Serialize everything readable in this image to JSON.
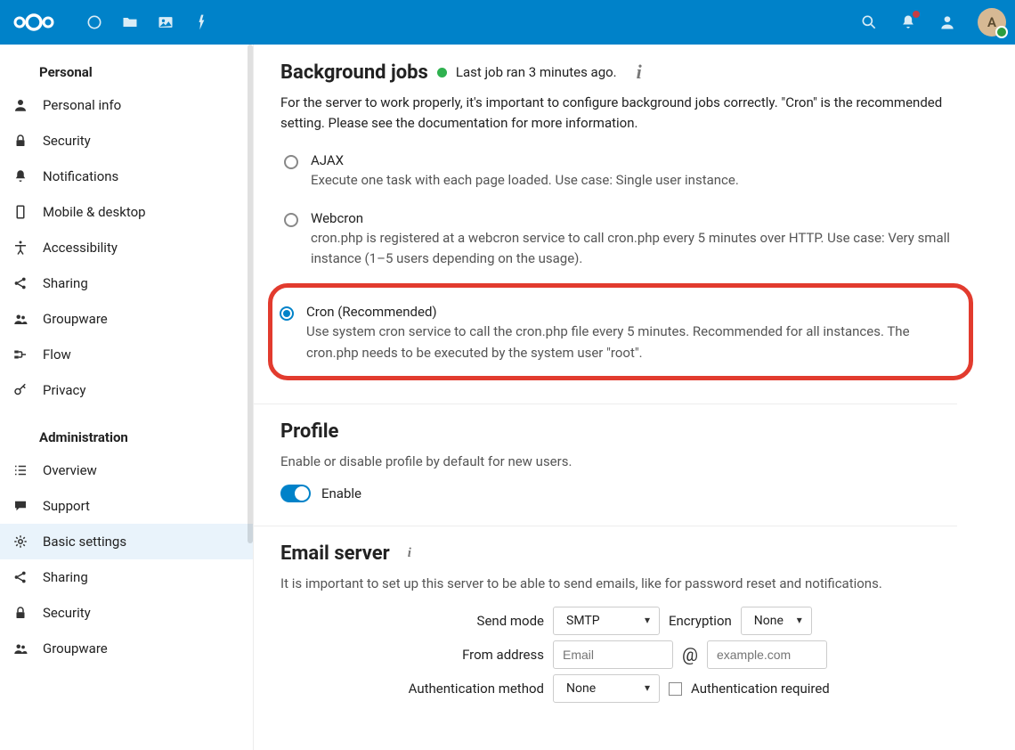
{
  "avatar_initial": "A",
  "sidebar": {
    "personal_heading": "Personal",
    "admin_heading": "Administration",
    "personal": [
      {
        "label": "Personal info"
      },
      {
        "label": "Security"
      },
      {
        "label": "Notifications"
      },
      {
        "label": "Mobile & desktop"
      },
      {
        "label": "Accessibility"
      },
      {
        "label": "Sharing"
      },
      {
        "label": "Groupware"
      },
      {
        "label": "Flow"
      },
      {
        "label": "Privacy"
      }
    ],
    "admin": [
      {
        "label": "Overview"
      },
      {
        "label": "Support"
      },
      {
        "label": "Basic settings"
      },
      {
        "label": "Sharing"
      },
      {
        "label": "Security"
      },
      {
        "label": "Groupware"
      }
    ]
  },
  "bgjobs": {
    "title": "Background jobs",
    "status": "Last job ran 3 minutes ago.",
    "desc": "For the server to work properly, it's important to configure background jobs correctly. \"Cron\" is the recommended setting. Please see the documentation for more information.",
    "options": {
      "ajax": {
        "label": "AJAX",
        "desc": "Execute one task with each page loaded. Use case: Single user instance."
      },
      "webcron": {
        "label": "Webcron",
        "desc": "cron.php is registered at a webcron service to call cron.php every 5 minutes over HTTP. Use case: Very small instance (1–5 users depending on the usage)."
      },
      "cron": {
        "label": "Cron (Recommended)",
        "desc": "Use system cron service to call the cron.php file every 5 minutes. Recommended for all instances. The cron.php needs to be executed by the system user \"root\"."
      }
    }
  },
  "profile": {
    "title": "Profile",
    "desc": "Enable or disable profile by default for new users.",
    "toggle_label": "Enable"
  },
  "email": {
    "title": "Email server",
    "desc": "It is important to set up this server to be able to send emails, like for password reset and notifications.",
    "labels": {
      "send_mode": "Send mode",
      "encryption": "Encryption",
      "from": "From address",
      "auth": "Authentication method",
      "auth_req": "Authentication required"
    },
    "values": {
      "send_mode": "SMTP",
      "encryption": "None",
      "auth": "None"
    },
    "placeholders": {
      "email": "Email",
      "domain": "example.com"
    }
  }
}
